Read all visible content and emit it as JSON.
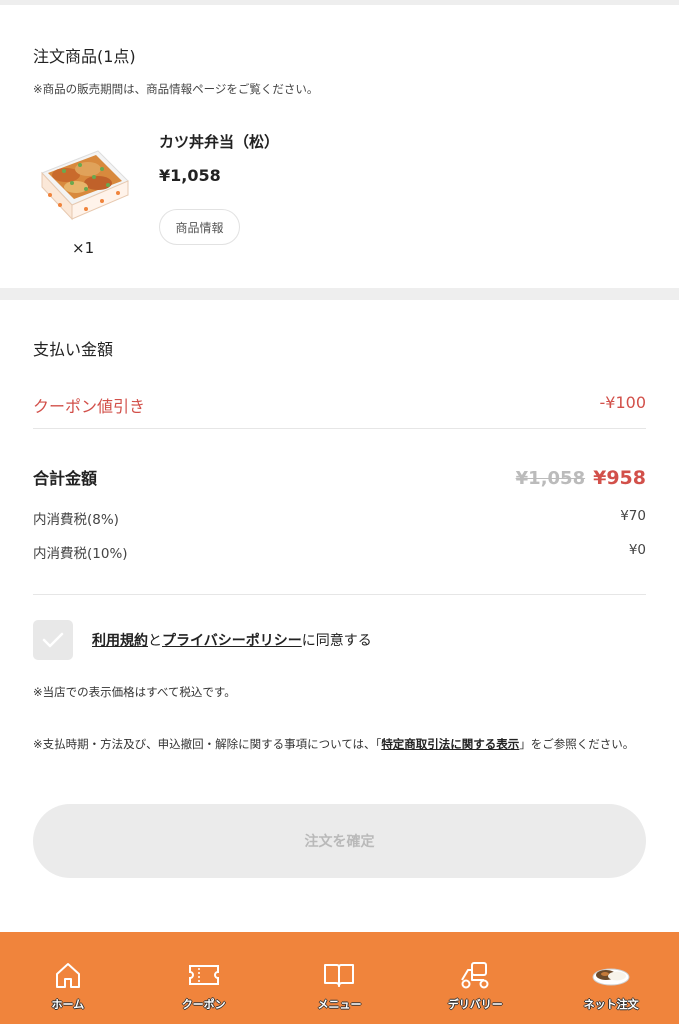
{
  "order": {
    "title": "注文商品(1点)",
    "note": "※商品の販売期間は、商品情報ページをご覧ください。",
    "product": {
      "name": "カツ丼弁当（松）",
      "price": "¥1,058",
      "qty": "×1",
      "info_button": "商品情報"
    }
  },
  "payment": {
    "title": "支払い金額",
    "coupon_label": "クーポン値引き",
    "coupon_value": "-¥100",
    "total_label": "合計金額",
    "total_original": "¥1,058",
    "total_final": "¥958",
    "tax8_label": "内消費税(8%)",
    "tax8_value": "¥70",
    "tax10_label": "内消費税(10%)",
    "tax10_value": "¥0"
  },
  "agreement": {
    "terms_link": "利用規約",
    "and": "と",
    "privacy_link": "プライバシーポリシー",
    "suffix": "に同意する"
  },
  "notes": {
    "tax_included": "※当店での表示価格はすべて税込です。",
    "law_prefix": "※支払時期・方法及び、申込撤回・解除に関する事項については、「",
    "law_link": "特定商取引法に関する表示",
    "law_suffix": "」をご参照ください。"
  },
  "confirm_button": "注文を確定",
  "bottom_nav": {
    "items": [
      {
        "label": "ホーム",
        "icon": "home-icon"
      },
      {
        "label": "クーポン",
        "icon": "ticket-icon"
      },
      {
        "label": "メニュー",
        "icon": "book-icon"
      },
      {
        "label": "デリバリー",
        "icon": "delivery-scooter-icon"
      },
      {
        "label": "ネット注文",
        "icon": "curry-dish-icon"
      }
    ]
  },
  "colors": {
    "accent_orange": "#f0843c",
    "discount_red": "#d2504a"
  }
}
